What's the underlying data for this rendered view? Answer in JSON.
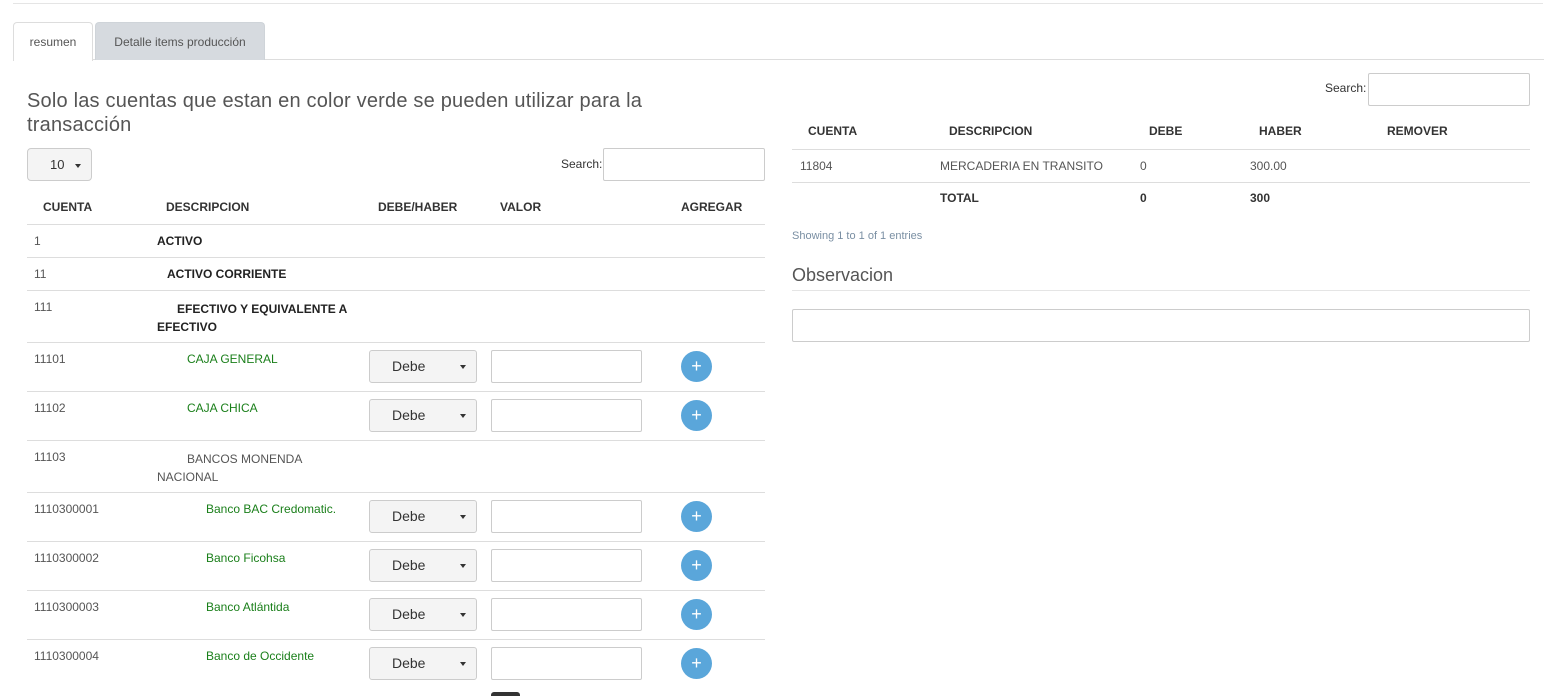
{
  "tabs": [
    {
      "label": "resumen"
    },
    {
      "label": "Detalle items producción"
    }
  ],
  "notice": "Solo las cuentas que estan en color verde se pueden utilizar para la transacción",
  "length_select": "10",
  "search_label": "Search:",
  "accounts_table": {
    "headers": [
      "CUENTA",
      "DESCRIPCION",
      "DEBE/HABER",
      "VALOR",
      "AGREGAR"
    ],
    "rows": [
      {
        "code": "1",
        "desc": "ACTIVO"
      },
      {
        "code": "11",
        "desc": "ACTIVO CORRIENTE"
      },
      {
        "code": "111",
        "desc": "EFECTIVO Y EQUIVALENTE A EFECTIVO"
      },
      {
        "code": "11101",
        "desc": "CAJA GENERAL",
        "select": "Debe",
        "add": "+"
      },
      {
        "code": "11102",
        "desc": "CAJA CHICA",
        "select": "Debe",
        "add": "+"
      },
      {
        "code": "11103",
        "desc": "BANCOS MONENDA NACIONAL"
      },
      {
        "code": "1110300001",
        "desc": "Banco BAC Credomatic.",
        "select": "Debe",
        "add": "+"
      },
      {
        "code": "1110300002",
        "desc": "Banco Ficohsa",
        "select": "Debe",
        "add": "+"
      },
      {
        "code": "1110300003",
        "desc": "Banco Atlántida",
        "select": "Debe",
        "add": "+"
      },
      {
        "code": "1110300004",
        "desc": "Banco de Occidente",
        "select": "Debe",
        "add": "+"
      }
    ]
  },
  "transaction_table": {
    "headers": [
      "CUENTA",
      "DESCRIPCION",
      "DEBE",
      "HABER",
      "REMOVER"
    ],
    "rows": [
      {
        "cuenta": "11804",
        "descripcion": "MERCADERIA EN TRANSITO",
        "debe": "0",
        "haber": "300.00"
      }
    ],
    "total": {
      "label": "TOTAL",
      "debe": "0",
      "haber": "300"
    }
  },
  "info": "Showing 1 to 1 of 1 entries",
  "observacion": "Observacion",
  "colors": {
    "usable_account": "#1a7f1a",
    "add_button": "#5aa6da"
  }
}
